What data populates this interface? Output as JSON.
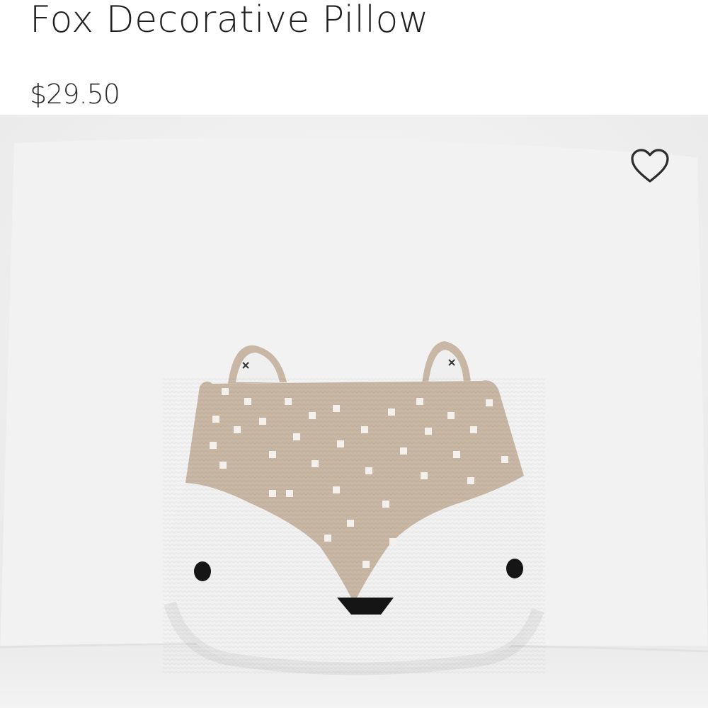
{
  "product": {
    "title": "Fox Decorative Pillow",
    "price": "$29.50"
  },
  "image": {
    "subject": "fox-pillow-photo"
  },
  "actions": {
    "favorite_icon": "heart-outline-icon"
  },
  "colors": {
    "text": "#1f1f1f",
    "pillow_tan": "#c8b7a4",
    "pillow_white": "#f1f1f1",
    "background": "#efefef"
  }
}
